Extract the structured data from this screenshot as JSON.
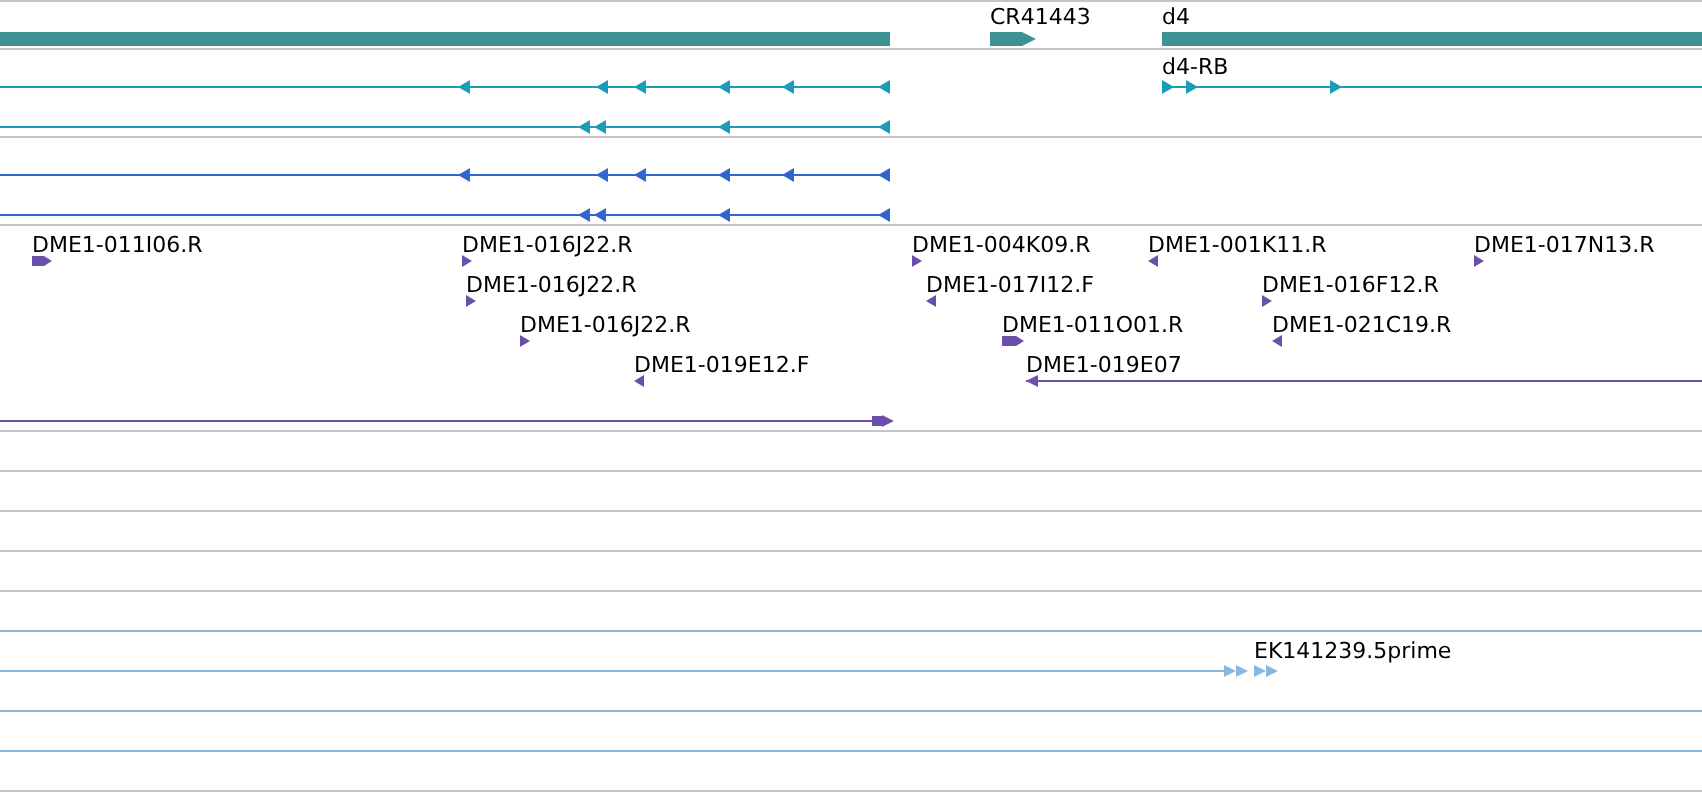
{
  "gene_track": {
    "genes": [
      {
        "name": "CR41443",
        "reverse": false
      },
      {
        "name": "d4"
      }
    ]
  },
  "transcript_track": {
    "transcripts": [
      {
        "name": "d4-RB",
        "reverse": false
      }
    ]
  },
  "est_track": {
    "alignments": [
      {
        "name": "DME1-011I06.R",
        "reverse": false
      },
      {
        "name": "DME1-016J22.R",
        "reverse": false
      },
      {
        "name": "DME1-016J22.R",
        "reverse": false
      },
      {
        "name": "DME1-016J22.R",
        "reverse": false
      },
      {
        "name": "DME1-019E12.F",
        "reverse": true
      },
      {
        "name": "DME1-004K09.R",
        "reverse": false
      },
      {
        "name": "DME1-017I12.F",
        "reverse": true
      },
      {
        "name": "DME1-011O01.R",
        "reverse": false
      },
      {
        "name": "DME1-019E07",
        "reverse": true
      },
      {
        "name": "DME1-001K11.R",
        "reverse": true
      },
      {
        "name": "DME1-016F12.R",
        "reverse": false
      },
      {
        "name": "DME1-021C19.R",
        "reverse": true
      },
      {
        "name": "DME1-017N13.R",
        "reverse": false
      }
    ]
  },
  "cdna_track": {
    "alignments": [
      {
        "name": "EK141239.5prime",
        "reverse": false
      }
    ]
  }
}
